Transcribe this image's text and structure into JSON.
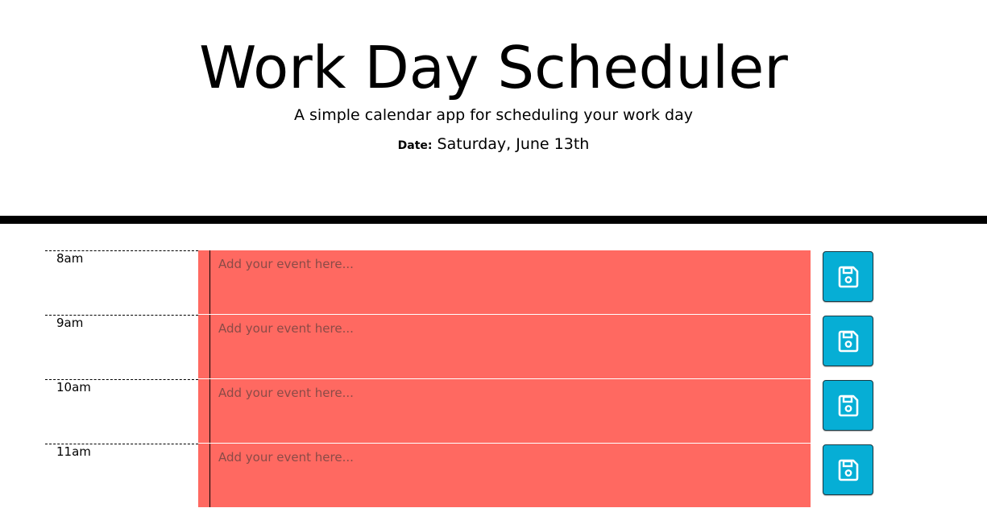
{
  "header": {
    "title": "Work Day Scheduler",
    "lead": "A simple calendar app for scheduling your work day",
    "date_label": "Date:",
    "date_value": "Saturday, June 13th"
  },
  "timeblocks": [
    {
      "hour": "8am",
      "placeholder": "Add your event here...",
      "icon": "save-icon"
    },
    {
      "hour": "9am",
      "placeholder": "Add your event here...",
      "icon": "save-icon"
    },
    {
      "hour": "10am",
      "placeholder": "Add your event here...",
      "icon": "save-icon"
    },
    {
      "hour": "11am",
      "placeholder": "Add your event here...",
      "icon": "save-icon"
    }
  ],
  "colors": {
    "past_block": "#ff6961",
    "save_button": "#06aed5",
    "divider": "#000000"
  }
}
